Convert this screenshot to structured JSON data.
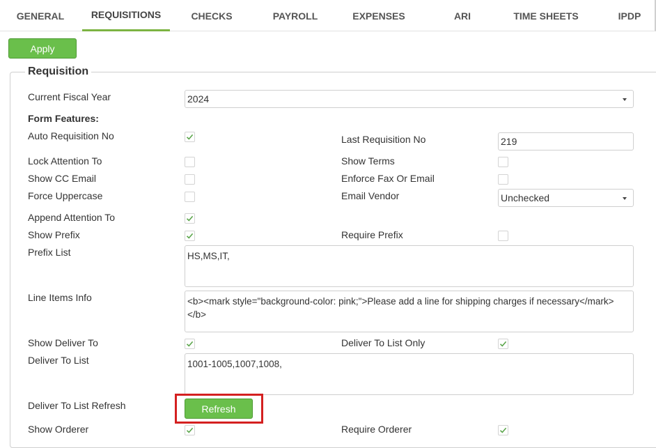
{
  "tabs": [
    {
      "label": "GENERAL"
    },
    {
      "label": "REQUISITIONS"
    },
    {
      "label": "CHECKS"
    },
    {
      "label": "PAYROLL"
    },
    {
      "label": "EXPENSES"
    },
    {
      "label": "ARI"
    },
    {
      "label": "TIME SHEETS"
    },
    {
      "label": "IPDP"
    }
  ],
  "active_tab": "REQUISITIONS",
  "apply_label": "Apply",
  "section_title": "Requisition",
  "fields": {
    "fiscal_year_label": "Current Fiscal Year",
    "fiscal_year_value": "2024",
    "form_features_label": "Form Features:",
    "auto_req_no_label": "Auto Requisition No",
    "auto_req_no_checked": true,
    "last_req_no_label": "Last Requisition No",
    "last_req_no_value": "219",
    "lock_attention_label": "Lock Attention To",
    "lock_attention_checked": false,
    "show_terms_label": "Show Terms",
    "show_terms_checked": false,
    "show_cc_email_label": "Show CC Email",
    "show_cc_email_checked": false,
    "enforce_fax_label": "Enforce Fax Or Email",
    "enforce_fax_checked": false,
    "force_uppercase_label": "Force Uppercase",
    "force_uppercase_checked": false,
    "email_vendor_label": "Email Vendor",
    "email_vendor_value": "Unchecked",
    "append_attention_label": "Append Attention To",
    "append_attention_checked": true,
    "show_prefix_label": "Show Prefix",
    "show_prefix_checked": true,
    "require_prefix_label": "Require Prefix",
    "require_prefix_checked": false,
    "prefix_list_label": "Prefix List",
    "prefix_list_value": "HS,MS,IT,",
    "line_items_label": "Line Items Info",
    "line_items_value": "<b><mark style=\"background-color: pink;\">Please add a line for shipping charges if necessary</mark></b>",
    "show_deliver_to_label": "Show Deliver To",
    "show_deliver_to_checked": true,
    "deliver_list_only_label": "Deliver To List Only",
    "deliver_list_only_checked": true,
    "deliver_to_list_label": "Deliver To List",
    "deliver_to_list_value": "1001-1005,1007,1008,",
    "deliver_refresh_label": "Deliver To List Refresh",
    "refresh_button_label": "Refresh",
    "show_orderer_label": "Show Orderer",
    "show_orderer_checked": true,
    "require_orderer_label": "Require Orderer",
    "require_orderer_checked": true
  },
  "colors": {
    "accent_green": "#6abf4b",
    "check_green": "#5aa54a",
    "highlight_red": "#d42020"
  }
}
